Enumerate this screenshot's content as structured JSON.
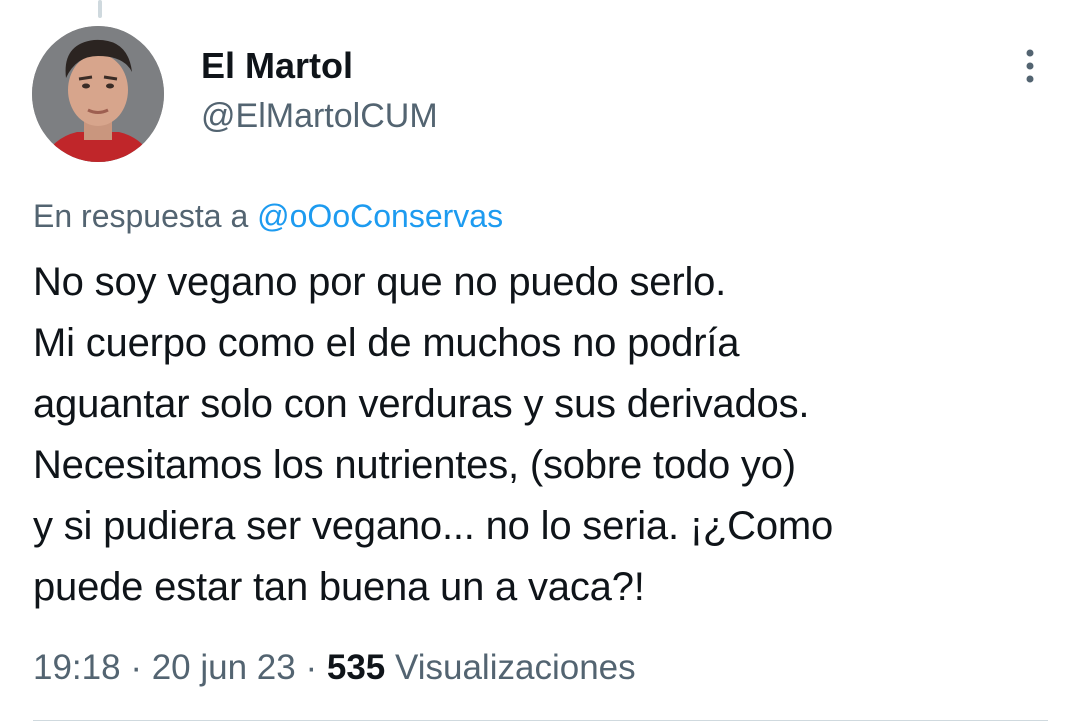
{
  "tweet": {
    "author": {
      "display_name": "El Martol",
      "handle": "@ElMartolCUM",
      "avatar_icon": "profile-photo"
    },
    "more_icon": "more-vertical-icon",
    "reply_prefix": "En respuesta a",
    "reply_mention": "@oOoConservas",
    "text_lines": [
      "No soy vegano por que no puedo serlo.",
      "Mi cuerpo como el de muchos no podría",
      "aguantar solo con verduras y sus derivados.",
      "Necesitamos los nutrientes, (sobre todo yo)",
      "y si pudiera ser vegano... no lo seria. ¡¿Como",
      "puede estar tan buena un a vaca?!"
    ],
    "time": "19:18",
    "separator": "·",
    "date": "20 jun 23",
    "views_count": "535",
    "views_label": "Visualizaciones"
  },
  "colors": {
    "text_primary": "#0f1419",
    "text_secondary": "#536471",
    "link": "#1d9bf0",
    "divider": "#cfd9de"
  }
}
